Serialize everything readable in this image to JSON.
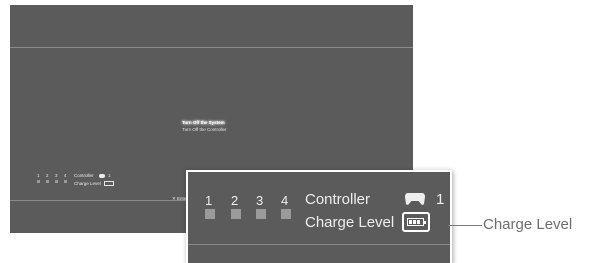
{
  "menu": {
    "items": [
      {
        "label": "Turn Off the System",
        "selected": true
      },
      {
        "label": "Turn Off the Controller",
        "selected": false
      }
    ]
  },
  "status": {
    "ports": [
      "1",
      "2",
      "3",
      "4"
    ],
    "controller_label": "Controller",
    "controller_port": "1",
    "charge_label": "Charge Level"
  },
  "footer": {
    "enter_hint": "✕ Enter"
  },
  "annotation": {
    "label": "Charge Level"
  },
  "colors": {
    "screen_bg": "#5b5b5b",
    "text": "#eeeeee",
    "callout_text": "#6e6e6e"
  },
  "icons": {
    "controller": "gamepad-icon",
    "battery": "battery-icon"
  }
}
